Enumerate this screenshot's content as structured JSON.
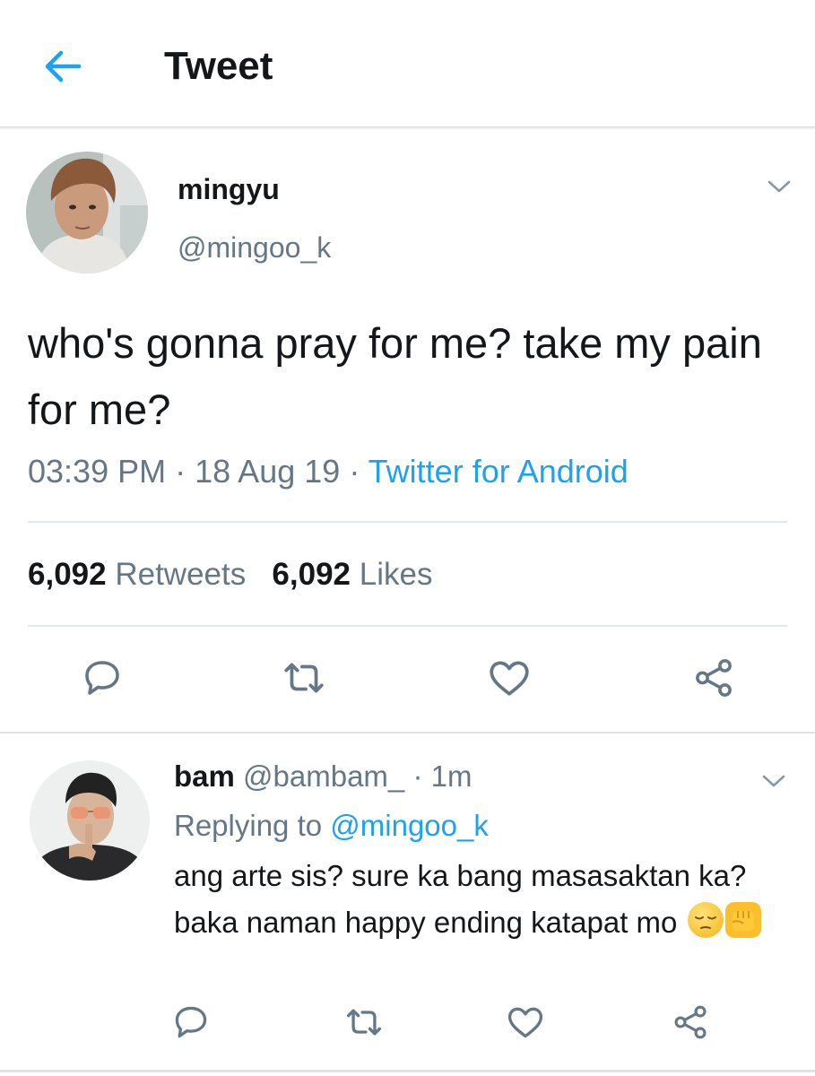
{
  "header": {
    "title": "Tweet",
    "back_icon": "arrow-left-icon"
  },
  "tweet": {
    "name": "mingyu",
    "handle": "@mingoo_k",
    "text": "who's gonna pray for me? take my pain for me?",
    "time": "03:39 PM",
    "date": "18 Aug 19",
    "source": "Twitter for Android",
    "dot": "·",
    "retweets_count": "6,092",
    "retweets_label": "Retweets",
    "likes_count": "6,092",
    "likes_label": "Likes",
    "actions": [
      "reply-icon",
      "retweet-icon",
      "like-icon",
      "share-icon"
    ]
  },
  "reply": {
    "name": "bam",
    "handle": "@bambam_",
    "dot": "·",
    "age": "1m",
    "replying_prefix": "Replying to",
    "replying_to": "@mingoo_k",
    "text": "ang arte sis? sure ka bang masasaktan ka? baka naman happy ending katapat mo",
    "emojis": [
      "pensive-face-emoji",
      "raised-fist-emoji"
    ],
    "actions": [
      "reply-icon",
      "retweet-icon",
      "like-icon",
      "share-icon"
    ]
  },
  "colors": {
    "accent": "#1da1f2",
    "text": "#14171a",
    "muted": "#657786",
    "divider": "#e1e8ed"
  }
}
